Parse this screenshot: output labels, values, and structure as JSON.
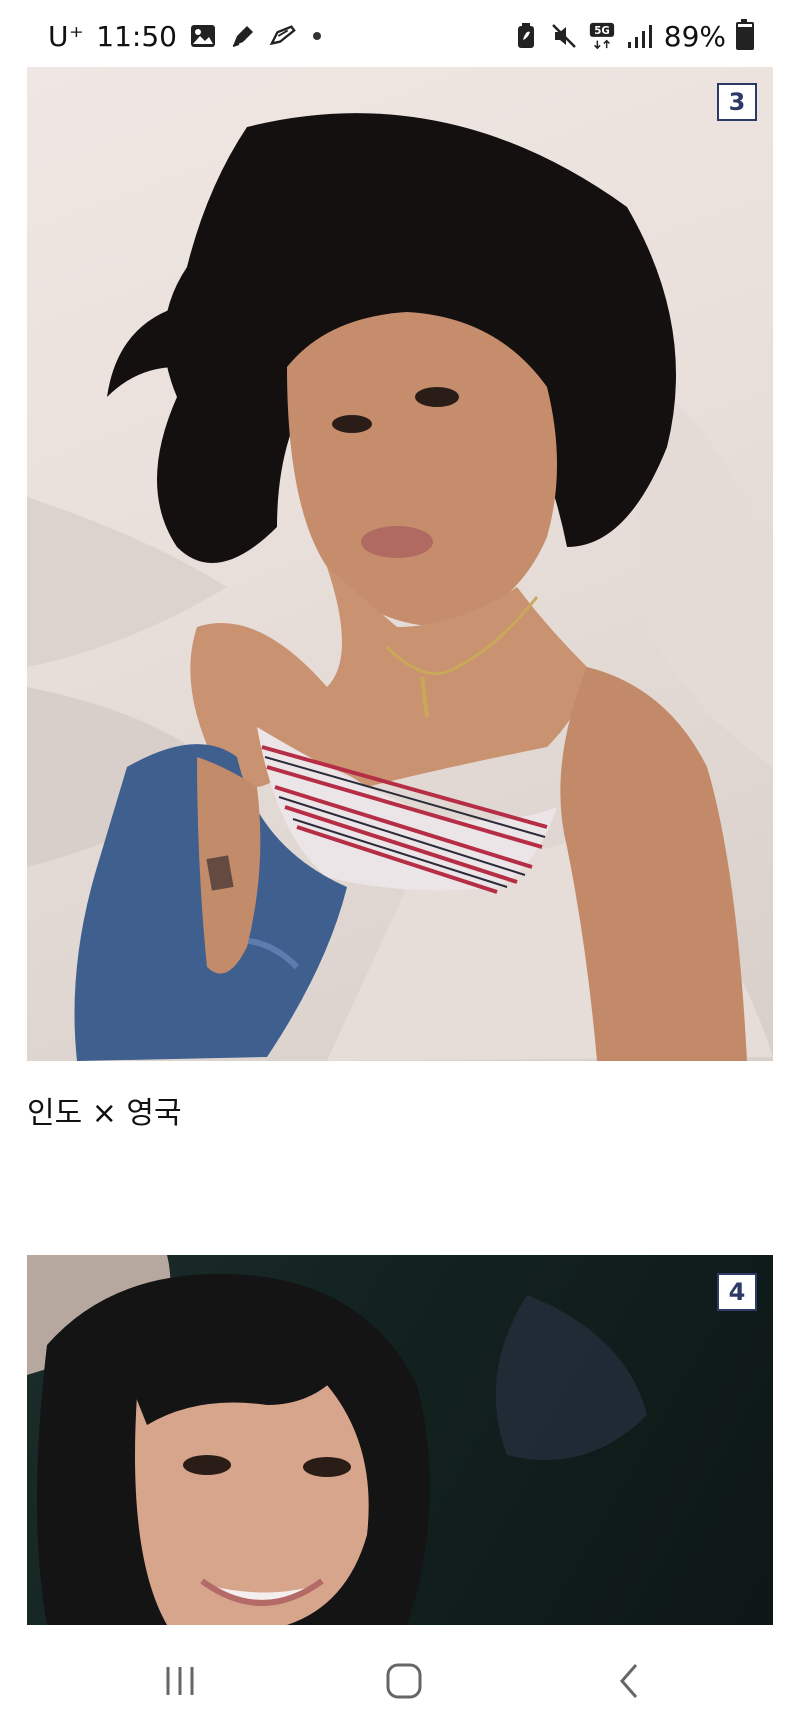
{
  "status_bar": {
    "carrier": "U⁺",
    "time": "11:50",
    "battery_percent": "89%",
    "battery_level": 0.89,
    "network": "5G",
    "icons_left": [
      "gallery-icon",
      "pen-icon",
      "note-icon"
    ],
    "icons_right": [
      "battery-saver-icon",
      "mute-icon",
      "5g-icon",
      "signal-icon"
    ]
  },
  "feed": {
    "items": [
      {
        "number": "3",
        "caption": "인도 × 영국"
      },
      {
        "number": "4",
        "caption": ""
      }
    ]
  },
  "nav_bar": {
    "buttons": [
      "recents-icon",
      "home-icon",
      "back-icon"
    ]
  }
}
